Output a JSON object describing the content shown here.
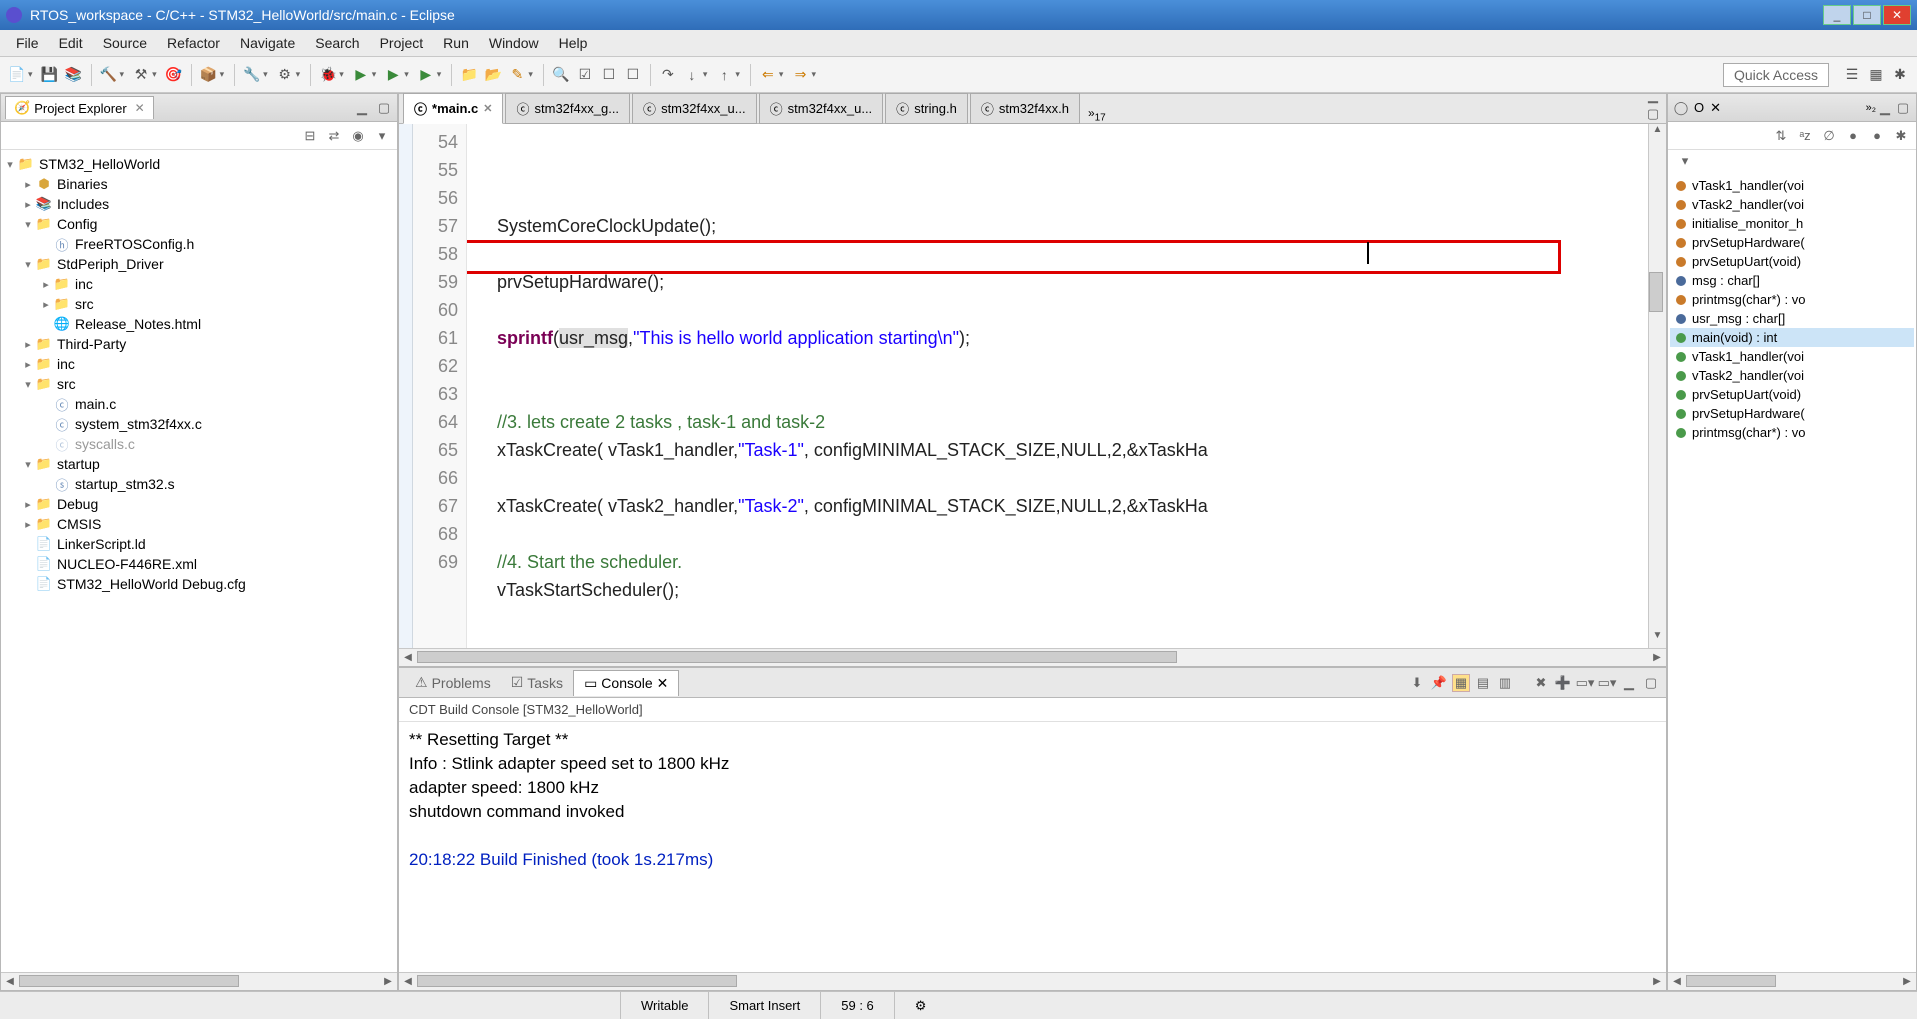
{
  "window": {
    "title": "RTOS_workspace - C/C++ - STM32_HelloWorld/src/main.c - Eclipse"
  },
  "menu": [
    "File",
    "Edit",
    "Source",
    "Refactor",
    "Navigate",
    "Search",
    "Project",
    "Run",
    "Window",
    "Help"
  ],
  "quick_access": "Quick Access",
  "explorer": {
    "title": "Project Explorer",
    "tree": [
      {
        "label": "STM32_HelloWorld",
        "depth": 0,
        "icon": "project",
        "expanded": true
      },
      {
        "label": "Binaries",
        "depth": 1,
        "icon": "bin",
        "expanded": false
      },
      {
        "label": "Includes",
        "depth": 1,
        "icon": "inc",
        "expanded": false
      },
      {
        "label": "Config",
        "depth": 1,
        "icon": "folder",
        "expanded": true
      },
      {
        "label": "FreeRTOSConfig.h",
        "depth": 2,
        "icon": "hfile"
      },
      {
        "label": "StdPeriph_Driver",
        "depth": 1,
        "icon": "folder",
        "expanded": true
      },
      {
        "label": "inc",
        "depth": 2,
        "icon": "folder",
        "expanded": false
      },
      {
        "label": "src",
        "depth": 2,
        "icon": "folder",
        "expanded": false
      },
      {
        "label": "Release_Notes.html",
        "depth": 2,
        "icon": "html"
      },
      {
        "label": "Third-Party",
        "depth": 1,
        "icon": "folder",
        "expanded": false
      },
      {
        "label": "inc",
        "depth": 1,
        "icon": "folder",
        "expanded": false
      },
      {
        "label": "src",
        "depth": 1,
        "icon": "folder",
        "expanded": true
      },
      {
        "label": "main.c",
        "depth": 2,
        "icon": "cfile"
      },
      {
        "label": "system_stm32f4xx.c",
        "depth": 2,
        "icon": "cfile"
      },
      {
        "label": "syscalls.c",
        "depth": 2,
        "icon": "cfile-dim"
      },
      {
        "label": "startup",
        "depth": 1,
        "icon": "folder",
        "expanded": true
      },
      {
        "label": "startup_stm32.s",
        "depth": 2,
        "icon": "sfile"
      },
      {
        "label": "Debug",
        "depth": 1,
        "icon": "folder",
        "expanded": false
      },
      {
        "label": "CMSIS",
        "depth": 1,
        "icon": "folder",
        "expanded": false
      },
      {
        "label": "LinkerScript.ld",
        "depth": 1,
        "icon": "file"
      },
      {
        "label": "NUCLEO-F446RE.xml",
        "depth": 1,
        "icon": "file"
      },
      {
        "label": "STM32_HelloWorld Debug.cfg",
        "depth": 1,
        "icon": "file"
      }
    ]
  },
  "editor": {
    "tabs": [
      {
        "label": "*main.c",
        "active": true
      },
      {
        "label": "stm32f4xx_g..."
      },
      {
        "label": "stm32f4xx_u..."
      },
      {
        "label": "stm32f4xx_u..."
      },
      {
        "label": "string.h"
      },
      {
        "label": "stm32f4xx.h"
      }
    ],
    "overflow": "17",
    "lines": [
      {
        "n": 54,
        "html": "    SystemCoreClockUpdate();"
      },
      {
        "n": 55,
        "html": ""
      },
      {
        "n": 56,
        "html": "    prvSetupHardware();"
      },
      {
        "n": 57,
        "html": ""
      },
      {
        "n": 58,
        "html": "    <span class='kw'>sprintf</span>(<span class='hl'>usr_msg</span>,<span class='str'>\"This is hello world application starting\\n\"</span>);",
        "highlighted": true
      },
      {
        "n": 59,
        "html": "    "
      },
      {
        "n": 60,
        "html": ""
      },
      {
        "n": 61,
        "html": "    <span class='cmt'>//3. lets create 2 tasks , task-1 and task-2</span>"
      },
      {
        "n": 62,
        "html": "    xTaskCreate( vTask1_handler,<span class='str'>\"Task-1\"</span>, configMINIMAL_STACK_SIZE,NULL,2,&xTaskHa"
      },
      {
        "n": 63,
        "html": ""
      },
      {
        "n": 64,
        "html": "    xTaskCreate( vTask2_handler,<span class='str'>\"Task-2\"</span>, configMINIMAL_STACK_SIZE,NULL,2,&xTaskHa"
      },
      {
        "n": 65,
        "html": ""
      },
      {
        "n": 66,
        "html": "    <span class='cmt'>//4. Start the scheduler.</span>"
      },
      {
        "n": 67,
        "html": "    vTaskStartScheduler();"
      },
      {
        "n": 68,
        "html": ""
      },
      {
        "n": 69,
        "html": ""
      }
    ]
  },
  "console": {
    "tabs": [
      "Problems",
      "Tasks",
      "Console"
    ],
    "active_tab": "Console",
    "title": "CDT Build Console [STM32_HelloWorld]",
    "lines": [
      {
        "text": "** Resetting Target **",
        "cls": ""
      },
      {
        "text": "Info : Stlink adapter speed set to 1800 kHz",
        "cls": ""
      },
      {
        "text": "adapter speed: 1800 kHz",
        "cls": ""
      },
      {
        "text": "shutdown command invoked",
        "cls": ""
      },
      {
        "text": "",
        "cls": ""
      },
      {
        "text": "20:18:22 Build Finished (took 1s.217ms)",
        "cls": "cblue"
      }
    ]
  },
  "outline": {
    "items": [
      {
        "label": "vTask1_handler(voi",
        "dot": "orange"
      },
      {
        "label": "vTask2_handler(voi",
        "dot": "orange"
      },
      {
        "label": "initialise_monitor_h",
        "dot": "orange"
      },
      {
        "label": "prvSetupHardware(",
        "dot": "orange"
      },
      {
        "label": "prvSetupUart(void)",
        "dot": "orange"
      },
      {
        "label": "msg : char[]",
        "dot": "blue"
      },
      {
        "label": "printmsg(char*) : vo",
        "dot": "orange"
      },
      {
        "label": "usr_msg : char[]",
        "dot": "blue"
      },
      {
        "label": "main(void) : int",
        "dot": "green",
        "selected": true
      },
      {
        "label": "vTask1_handler(voi",
        "dot": "green"
      },
      {
        "label": "vTask2_handler(voi",
        "dot": "green"
      },
      {
        "label": "prvSetupUart(void)",
        "dot": "green"
      },
      {
        "label": "prvSetupHardware(",
        "dot": "green"
      },
      {
        "label": "printmsg(char*) : vo",
        "dot": "green"
      }
    ]
  },
  "status": {
    "writable": "Writable",
    "insert": "Smart Insert",
    "pos": "59 : 6"
  }
}
